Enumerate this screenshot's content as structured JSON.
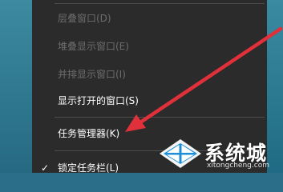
{
  "context_menu": {
    "items": [
      {
        "label": "层叠窗口(D)",
        "enabled": false,
        "checked": false
      },
      {
        "label": "堆叠显示窗口(E)",
        "enabled": false,
        "checked": false
      },
      {
        "label": "并排显示窗口(I)",
        "enabled": false,
        "checked": false
      },
      {
        "label": "显示打开的窗口(S)",
        "enabled": true,
        "checked": false
      },
      {
        "label": "任务管理器(K)",
        "enabled": true,
        "checked": false
      },
      {
        "label": "锁定任务栏(L)",
        "enabled": true,
        "checked": true
      }
    ],
    "check_glyph": "✓"
  },
  "annotation": {
    "arrow_color": "#e0303a",
    "points_to": "任务管理器(K)"
  },
  "watermark": {
    "brand": "系统城",
    "url": "xitongcheng.com",
    "logo_color": "#1e8fd6"
  },
  "colors": {
    "menu_background": "#2b2b2b",
    "menu_text": "#ffffff",
    "menu_text_disabled": "#6d6d6d",
    "separator": "#4d4d4d",
    "desktop": "#2f7890"
  }
}
